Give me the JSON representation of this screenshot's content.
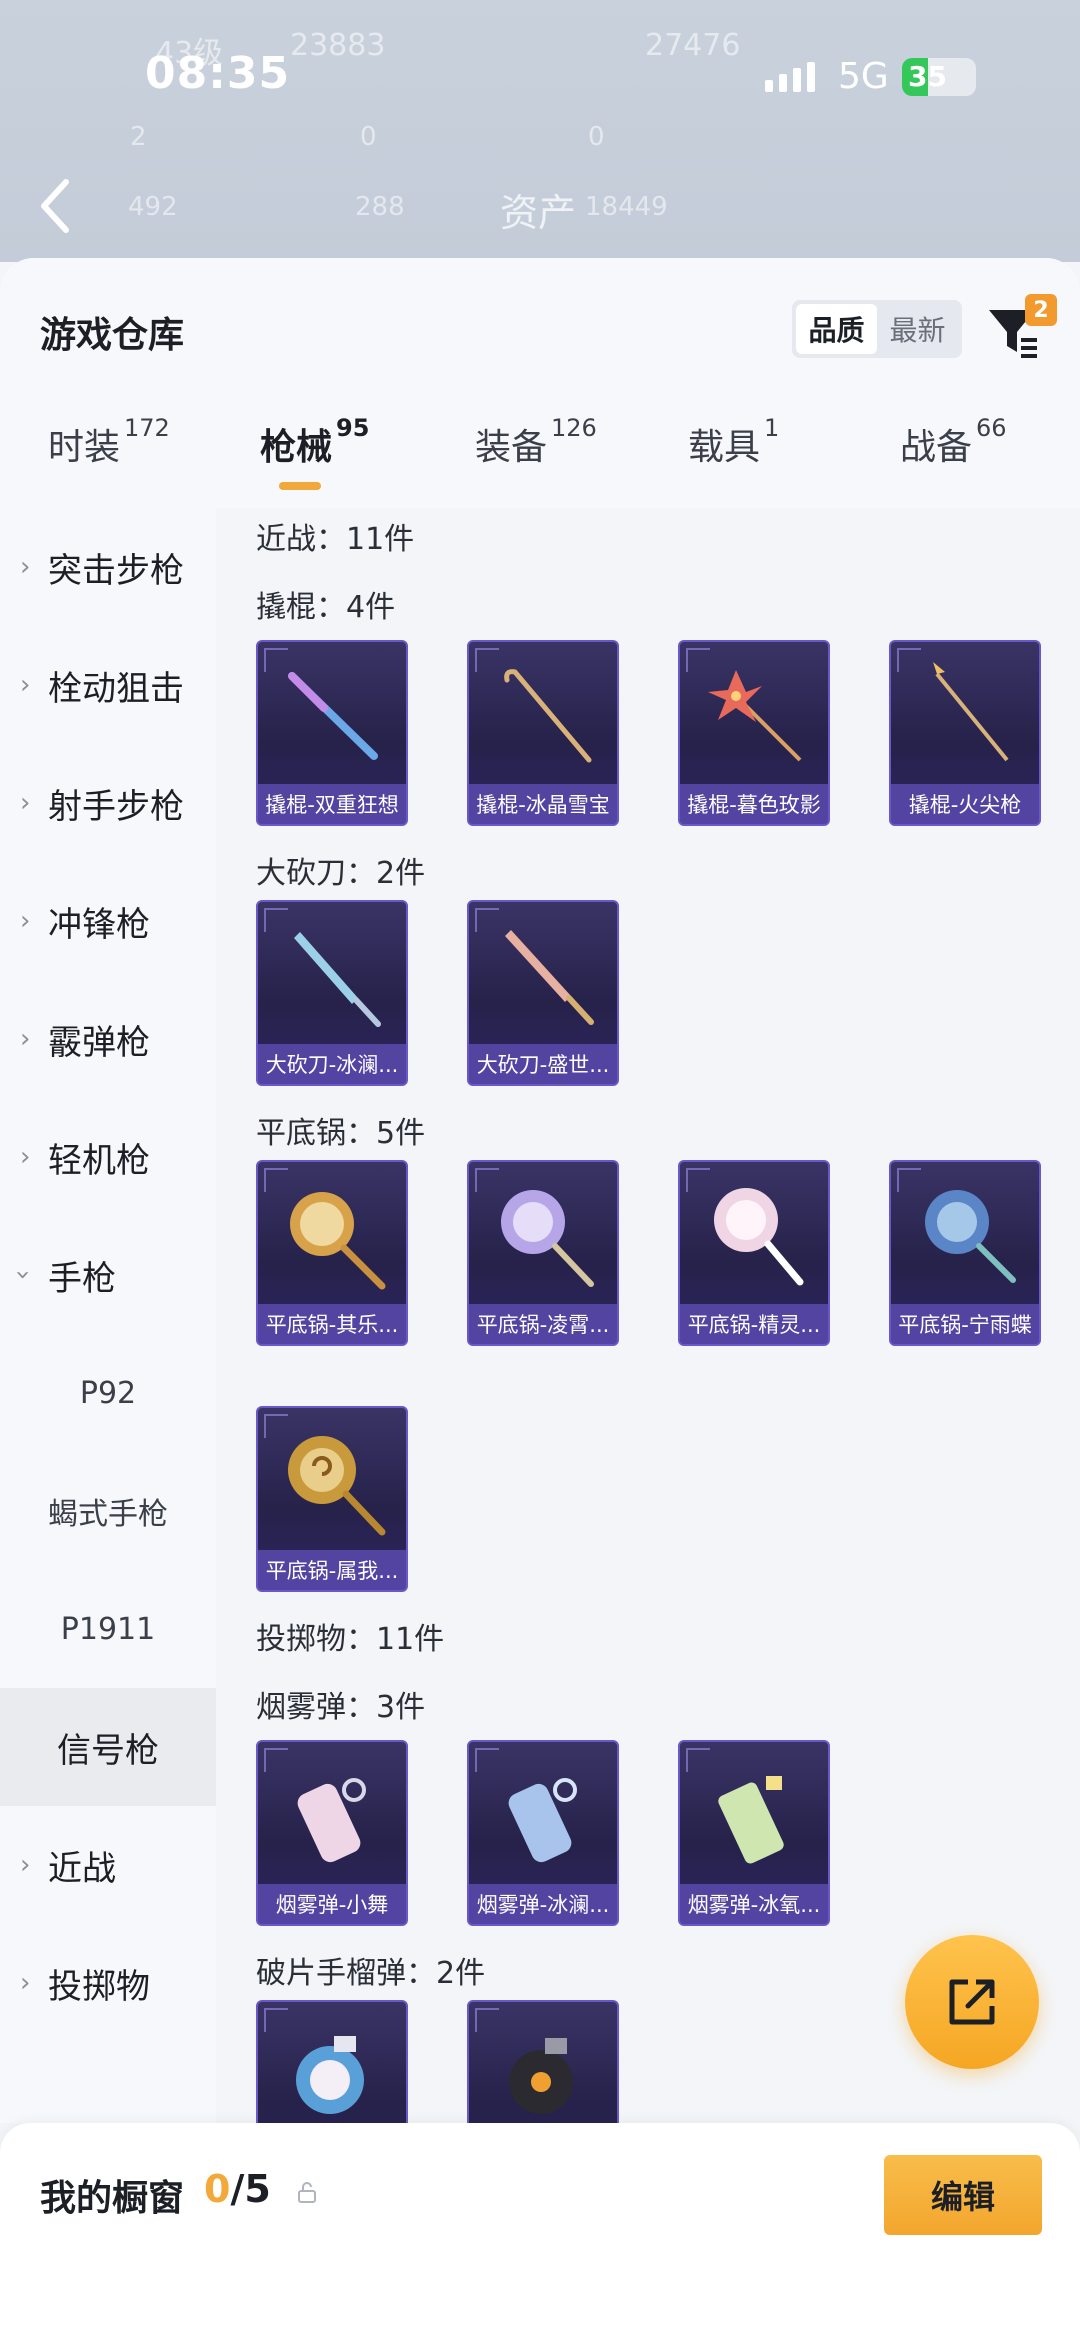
{
  "status_bar": {
    "time": "08:35",
    "network": "5G",
    "battery": "35"
  },
  "backdrop": {
    "level": "43级",
    "coins": "23883",
    "score2": "27476",
    "stat_a": "2",
    "stat_b": "0",
    "stat_c": "0",
    "asset_left": "492",
    "asset_mid": "288",
    "asset_label": "资产",
    "asset_value": "18449"
  },
  "header": {
    "title": "游戏仓库",
    "sort_options": [
      "品质",
      "最新"
    ],
    "filter_badge": "2"
  },
  "tabs": [
    {
      "label": "时装",
      "count": "172"
    },
    {
      "label": "枪械",
      "count": "95"
    },
    {
      "label": "装备",
      "count": "126"
    },
    {
      "label": "载具",
      "count": "1"
    },
    {
      "label": "战备",
      "count": "66"
    }
  ],
  "sidebar": [
    {
      "label": "突击步枪",
      "expandable": true
    },
    {
      "label": "栓动狙击",
      "expandable": true
    },
    {
      "label": "射手步枪",
      "expandable": true
    },
    {
      "label": "冲锋枪",
      "expandable": true
    },
    {
      "label": "霰弹枪",
      "expandable": true
    },
    {
      "label": "轻机枪",
      "expandable": true
    },
    {
      "label": "手枪",
      "expandable": true,
      "expanded": true
    },
    {
      "label": "P92",
      "sub": true
    },
    {
      "label": "蝎式手枪",
      "sub": true
    },
    {
      "label": "P1911",
      "sub": true
    },
    {
      "label": "信号枪",
      "sub": true,
      "selected": true
    },
    {
      "label": "近战",
      "expandable": true
    },
    {
      "label": "投掷物",
      "expandable": true
    }
  ],
  "sections": {
    "melee": "近战：11件",
    "crowbar": "撬棍：4件",
    "machete": "大砍刀：2件",
    "pan": "平底锅：5件",
    "throwables": "投掷物：11件",
    "smoke": "烟雾弹：3件",
    "frag": "破片手榴弹：2件"
  },
  "items": {
    "crowbar": [
      "撬棍-双重狂想",
      "撬棍-冰晶雪宝",
      "撬棍-暮色玫影",
      "撬棍-火尖枪"
    ],
    "machete": [
      "大砍刀-冰澜...",
      "大砍刀-盛世..."
    ],
    "pan": [
      "平底锅-其乐...",
      "平底锅-凌霄...",
      "平底锅-精灵...",
      "平底锅-宁雨蝶",
      "平底锅-属我..."
    ],
    "smoke": [
      "烟雾弹-小舞",
      "烟雾弹-冰澜...",
      "烟雾弹-冰氧..."
    ]
  },
  "bottom_bar": {
    "title": "我的橱窗",
    "current": "0",
    "total": "/5",
    "edit_label": "编辑"
  },
  "colors": {
    "accent": "#f3a93a",
    "card_border": "#6b57c9"
  }
}
